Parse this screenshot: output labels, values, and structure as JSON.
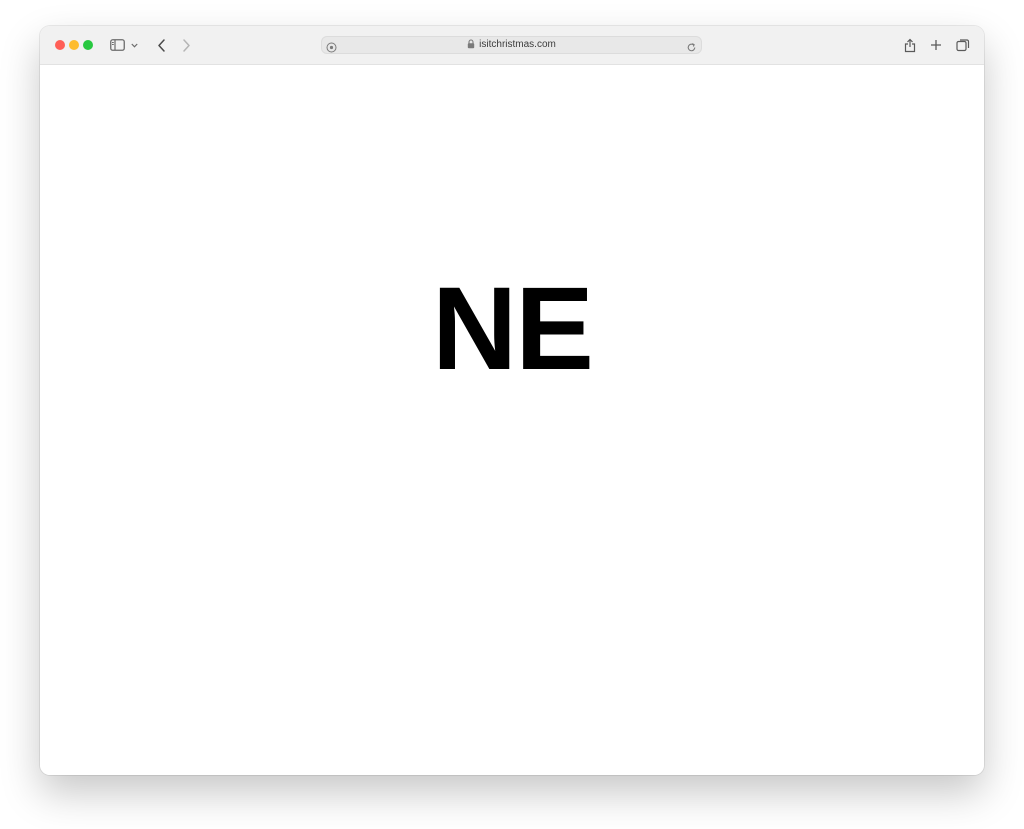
{
  "browser": {
    "address_bar": {
      "url": "isitchristmas.com"
    },
    "icons": {
      "sidebar": "sidebar-icon",
      "sidebar_menu": "chevron-down-icon",
      "back": "chevron-left-icon",
      "forward": "chevron-right-icon",
      "privacy": "shield-icon",
      "lock": "lock-icon",
      "reload": "reload-icon",
      "share": "share-icon",
      "new_tab": "plus-icon",
      "tabs": "tabs-overview-icon"
    },
    "colors": {
      "close": "#ff5f57",
      "minimize": "#febc2e",
      "maximize": "#28c840"
    }
  },
  "page": {
    "answer": "NE"
  }
}
